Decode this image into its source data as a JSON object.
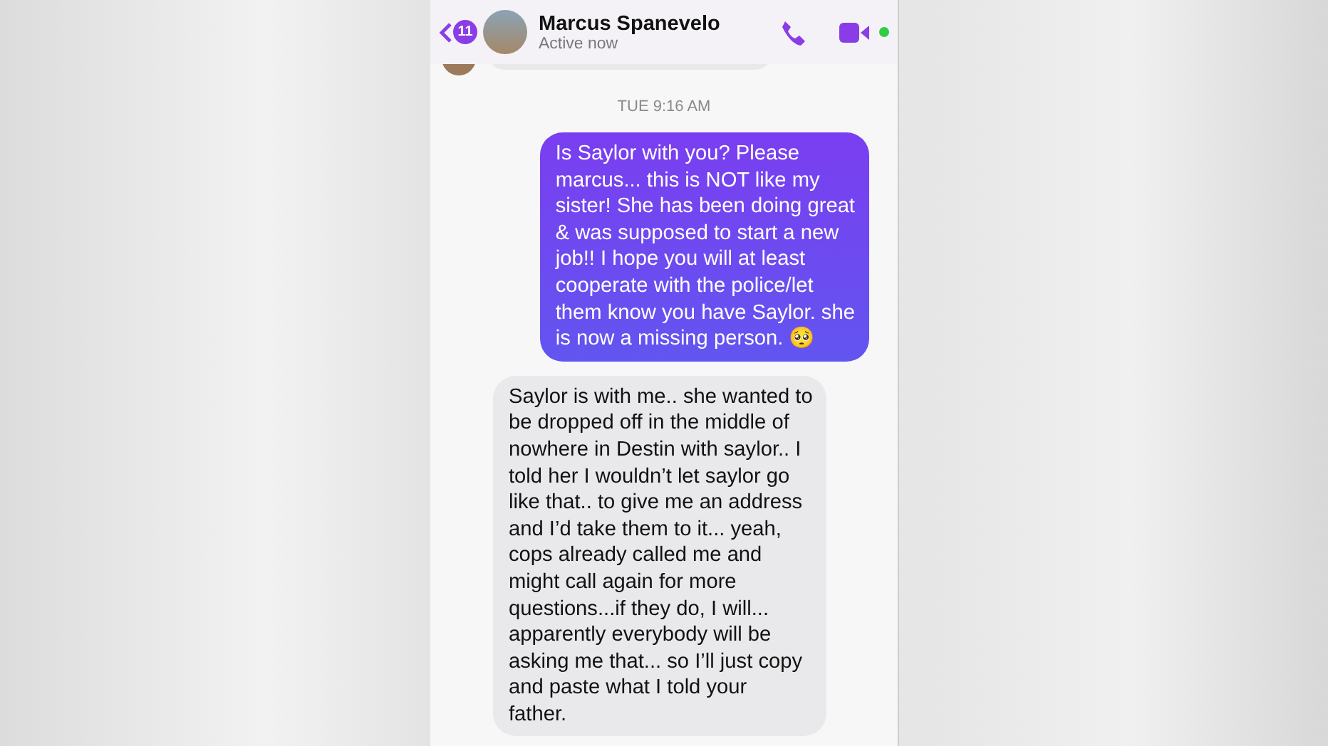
{
  "header": {
    "back_count": "11",
    "contact_name": "Marcus Spanevelo",
    "status": "Active now",
    "online": true
  },
  "timestamp": "TUE 9:16 AM",
  "messages": [
    {
      "kind": "sent",
      "text": "Is Saylor with you? Please\nmarcus... this is NOT like my\nsister! She has been doing great\n& was supposed to start a new\njob!! I hope you will at least\ncooperate with the police/let\nthem know you have Saylor. she\nis now a missing person. 🥺"
    },
    {
      "kind": "received",
      "text": "Saylor is with me.. she wanted to\nbe dropped off in the middle of\nnowhere in Destin with saylor.. I\ntold her I wouldn’t let saylor go\nlike that.. to give me an address\nand I’d take them to it... yeah,\ncops already called me and\nmight call again for more\nquestions...if they do, I will...\napparently everybody will be\nasking me that... so I’ll just copy\nand paste what I told your\nfather."
    }
  ]
}
